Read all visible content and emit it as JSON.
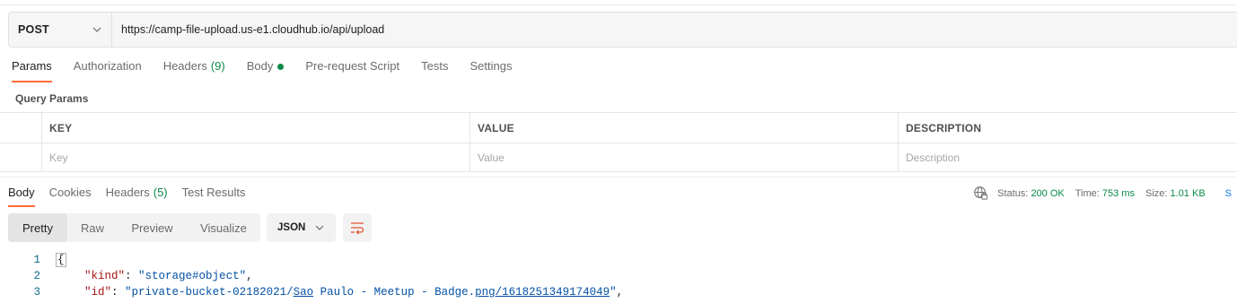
{
  "request": {
    "method": "POST",
    "url": "https://camp-file-upload.us-e1.cloudhub.io/api/upload"
  },
  "request_tabs": [
    {
      "label": "Params",
      "active": true
    },
    {
      "label": "Authorization"
    },
    {
      "label": "Headers",
      "count": "(9)"
    },
    {
      "label": "Body",
      "has_content_dot": true
    },
    {
      "label": "Pre-request Script"
    },
    {
      "label": "Tests"
    },
    {
      "label": "Settings"
    }
  ],
  "query_params": {
    "section_label": "Query Params",
    "columns": {
      "key": "KEY",
      "value": "VALUE",
      "description": "DESCRIPTION"
    },
    "placeholders": {
      "key": "Key",
      "value": "Value",
      "description": "Description"
    }
  },
  "response_tabs": [
    {
      "label": "Body",
      "active": true
    },
    {
      "label": "Cookies"
    },
    {
      "label": "Headers",
      "count": "(5)"
    },
    {
      "label": "Test Results"
    }
  ],
  "response_status": {
    "icon": "globe-lock-icon",
    "status_label": "Status:",
    "status_value": "200 OK",
    "time_label": "Time:",
    "time_value": "753 ms",
    "size_label": "Size:",
    "size_value": "1.01 KB",
    "trailing": "S"
  },
  "view_modes": [
    "Pretty",
    "Raw",
    "Preview",
    "Visualize"
  ],
  "active_view": "Pretty",
  "format": "JSON",
  "wrap_icon": "wrap-lines-icon",
  "code": {
    "line_numbers": [
      "1",
      "2",
      "3"
    ],
    "open_brace": "{",
    "line2": {
      "key": "\"kind\"",
      "colon": ": ",
      "value": "\"storage#object\"",
      "comma": ","
    },
    "line3": {
      "key": "\"id\"",
      "colon": ": ",
      "value_prefix": "\"private-bucket-02182021/",
      "value_link1": "Sao",
      "value_middle": " Paulo - Meetup - Badge.",
      "value_link2": "png/1618251349174049",
      "value_suffix": "\"",
      "comma": ","
    }
  },
  "colors": {
    "accent": "#ff6c37",
    "success": "#0b8a4a",
    "link": "#097bed"
  }
}
